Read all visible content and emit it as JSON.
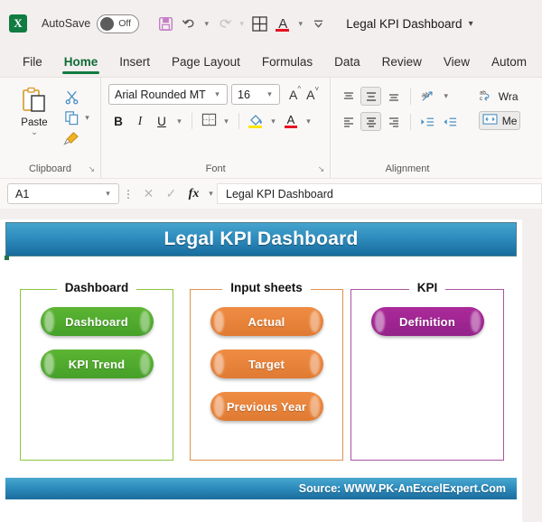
{
  "titlebar": {
    "app_icon": "excel-logo-icon",
    "app_icon_letter": "X",
    "autosave_label": "AutoSave",
    "autosave_state": "Off",
    "document_title": "Legal KPI Dashboard",
    "quick_access": [
      {
        "name": "save-icon",
        "glyph": "💾"
      },
      {
        "name": "undo-icon",
        "glyph": "↶"
      },
      {
        "name": "redo-icon",
        "glyph": "↷"
      },
      {
        "name": "table-grid-icon",
        "glyph": ""
      },
      {
        "name": "font-color-icon",
        "glyph": "A"
      },
      {
        "name": "customize-toolbar-icon",
        "glyph": "⌄"
      }
    ]
  },
  "ribbon_tabs": [
    {
      "label": "File",
      "active": false
    },
    {
      "label": "Home",
      "active": true
    },
    {
      "label": "Insert",
      "active": false
    },
    {
      "label": "Page Layout",
      "active": false
    },
    {
      "label": "Formulas",
      "active": false
    },
    {
      "label": "Data",
      "active": false
    },
    {
      "label": "Review",
      "active": false
    },
    {
      "label": "View",
      "active": false
    },
    {
      "label": "Autom",
      "active": false
    }
  ],
  "ribbon": {
    "clipboard": {
      "group_label": "Clipboard",
      "paste_label": "Paste",
      "paste_caret": "⌄",
      "cut_icon": "scissors-icon",
      "copy_icon": "copy-icon",
      "format_painter_icon": "format-painter-icon",
      "dialog_launcher": "↘"
    },
    "font": {
      "group_label": "Font",
      "font_name": "Arial Rounded MT",
      "font_size": "16",
      "grow_font": "A",
      "shrink_font": "A",
      "bold": "B",
      "italic": "I",
      "underline": "U",
      "borders_icon": "borders-icon",
      "fill_color_icon": "fill-color-icon",
      "font_color_letter": "A",
      "dialog_launcher": "↘"
    },
    "alignment": {
      "group_label": "Alignment",
      "top_align": "top-align-icon",
      "middle_align": "middle-align-icon",
      "bottom_align": "bottom-align-icon",
      "orientation": "text-orientation-icon",
      "align_left": "align-left-icon",
      "align_center": "align-center-icon",
      "align_right": "align-right-icon",
      "decrease_indent": "decrease-indent-icon",
      "increase_indent": "increase-indent-icon",
      "wrap_text_label": "Wra",
      "merge_center_label": "Me"
    }
  },
  "formula_bar": {
    "name_box_value": "A1",
    "name_box_caret": "⌄",
    "cancel_icon": "✕",
    "enter_icon": "✓",
    "function_icon": "fx",
    "function_caret": "⌄",
    "formula_value": "Legal KPI Dashboard"
  },
  "sheet": {
    "banner_title": "Legal KPI Dashboard",
    "footer_text": "Source: WWW.PK-AnExcelExpert.Com",
    "groups": [
      {
        "title": "Dashboard",
        "color": "#8cc63f",
        "pill_class": "green",
        "buttons": [
          "Dashboard",
          "KPI Trend"
        ]
      },
      {
        "title": "Input sheets",
        "color": "#e0914e",
        "pill_class": "orange",
        "buttons": [
          "Actual",
          "Target",
          "Previous Year"
        ]
      },
      {
        "title": "KPI",
        "color": "#a855a0",
        "pill_class": "purple",
        "buttons": [
          "Definition"
        ]
      }
    ]
  },
  "colors": {
    "excel_green": "#107c41",
    "banner_blue_top": "#46a3cd",
    "banner_blue_bottom": "#176b9c",
    "green_pill": "#4ba82e",
    "orange_pill": "#e8813a",
    "purple_pill": "#a0258f",
    "window_bg": "#f3efee",
    "outside_bg": "#efeae8"
  }
}
